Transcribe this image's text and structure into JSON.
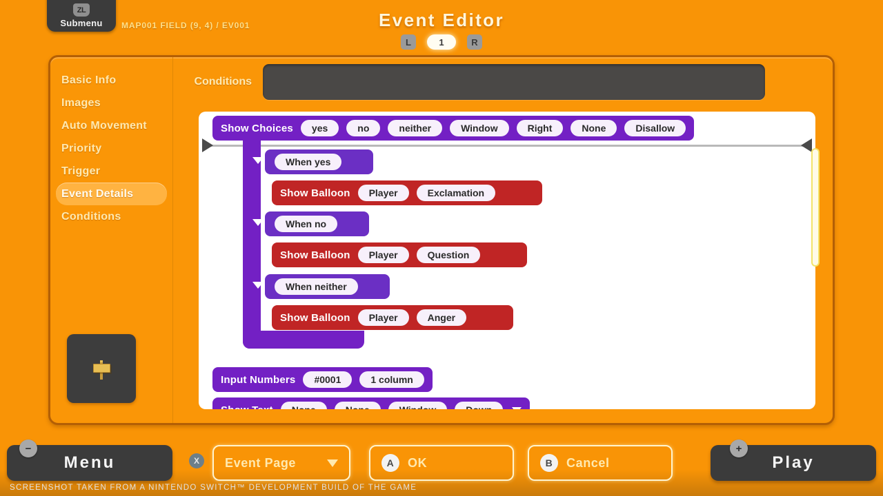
{
  "header": {
    "submenu_key": "ZL",
    "submenu_label": "Submenu",
    "breadcrumb": "MAP001 FIELD (9, 4) / EV001",
    "title": "Event Editor",
    "page_prev_key": "L",
    "page_number": "1",
    "page_next_key": "R"
  },
  "sidebar": {
    "items": [
      {
        "label": "Basic Info",
        "active": false
      },
      {
        "label": "Images",
        "active": false
      },
      {
        "label": "Auto Movement",
        "active": false
      },
      {
        "label": "Priority",
        "active": false
      },
      {
        "label": "Trigger",
        "active": false
      },
      {
        "label": "Event Details",
        "active": true
      },
      {
        "label": "Conditions",
        "active": false
      }
    ],
    "thumbnail_icon": "signpost-sprite"
  },
  "conditions": {
    "label": "Conditions",
    "value": ""
  },
  "event_list": {
    "commands": [
      {
        "name": "Show Choices",
        "args": [
          "yes",
          "no",
          "neither",
          "Window",
          "Right",
          "None",
          "Disallow"
        ]
      },
      {
        "name": "When yes",
        "args": []
      },
      {
        "name": "Show Balloon",
        "args": [
          "Player",
          "Exclamation"
        ]
      },
      {
        "name": "When no",
        "args": []
      },
      {
        "name": "Show Balloon",
        "args": [
          "Player",
          "Question"
        ]
      },
      {
        "name": "When neither",
        "args": []
      },
      {
        "name": "Show Balloon",
        "args": [
          "Player",
          "Anger"
        ]
      },
      {
        "name": "Input Numbers",
        "args": [
          "#0001",
          "1 column"
        ]
      },
      {
        "name": "Show Text",
        "args": [
          "None",
          "None",
          "Window",
          "Down"
        ]
      }
    ],
    "scroll_position_percent": 18
  },
  "bottom_bar": {
    "menu_key": "−",
    "menu_label": "Menu",
    "event_page_key": "X",
    "event_page_label": "Event Page",
    "ok_key": "A",
    "ok_label": "OK",
    "cancel_key": "B",
    "cancel_label": "Cancel",
    "play_key": "+",
    "play_label": "Play"
  },
  "footer": {
    "note": "Screenshot taken from a Nintendo Switch™ development build of the game"
  },
  "colors": {
    "background_orange": "#F99406",
    "panel_border": "#B35F05",
    "active_item": "#FFB341",
    "command_purple": "#7320C4",
    "command_red": "#C02525",
    "arg_pill": "#F7F0FB"
  }
}
